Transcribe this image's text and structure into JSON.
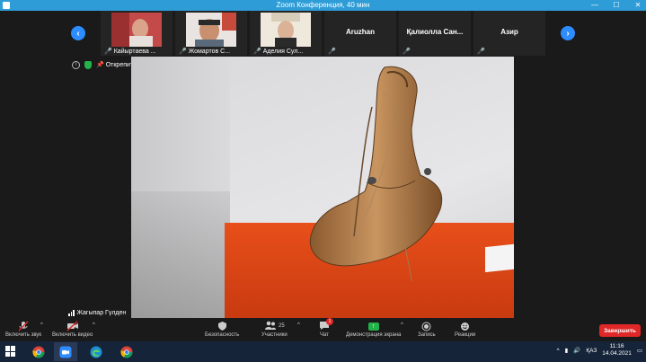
{
  "window": {
    "title": "Zoom Конференция, 40 мин"
  },
  "gallery": {
    "tiles": [
      {
        "name": "Кайыртаева ...",
        "type": "video"
      },
      {
        "name": "Жомартов С...",
        "type": "video"
      },
      {
        "name": "Аделия Сул...",
        "type": "video"
      },
      {
        "name": "Aruzhan",
        "type": "name"
      },
      {
        "name": "Қалиолла  Сан...",
        "type": "name"
      },
      {
        "name": "Азир",
        "type": "name"
      }
    ]
  },
  "video_info": {
    "pin_label": "Открепить видео"
  },
  "main_video": {
    "speaker": "Жагыпар Гүлден"
  },
  "toolbar": {
    "unmute": "Включить звук",
    "start_video": "Включить видео",
    "security": "Безопасность",
    "participants": "Участники",
    "participants_count": "25",
    "chat": "Чат",
    "chat_badge": "1",
    "share": "Демонстрация экрана",
    "record": "Запись",
    "reactions": "Реакции",
    "end": "Завершить"
  },
  "taskbar": {
    "lang": "ҚАЗ",
    "time": "11:16",
    "date": "14.04.2021"
  },
  "colors": {
    "accent": "#2d8cff",
    "end": "#e02828",
    "share": "#23b34a",
    "titlebar": "#2e9cd6"
  }
}
